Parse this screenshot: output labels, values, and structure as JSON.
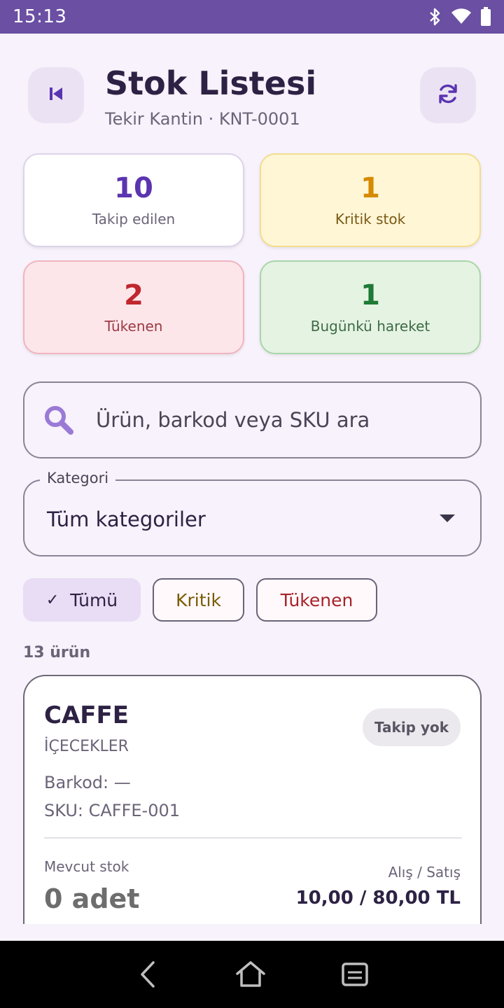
{
  "status_bar": {
    "time": "15:13"
  },
  "header": {
    "title": "Stok Listesi",
    "subtitle": "Tekir Kantin · KNT-0001"
  },
  "stats": {
    "tracked": {
      "value": "10",
      "label": "Takip edilen"
    },
    "critical": {
      "value": "1",
      "label": "Kritik stok"
    },
    "out": {
      "value": "2",
      "label": "Tükenen"
    },
    "moves": {
      "value": "1",
      "label": "Bugünkü hareket"
    }
  },
  "search": {
    "placeholder": "Ürün, barkod veya SKU ara",
    "value": ""
  },
  "category_select": {
    "label": "Kategori",
    "selected": "Tüm kategoriler"
  },
  "filters": {
    "all": "Tümü",
    "critical": "Kritik",
    "out": "Tükenen",
    "selected": "all"
  },
  "result_count": "13 ürün",
  "products": [
    {
      "name": "CAFFE",
      "category": "İÇECEKLER",
      "badge": "Takip yok",
      "barcode": "Barkod: —",
      "sku": "SKU: CAFFE-001",
      "stock_label": "Mevcut stok",
      "stock_value": "0 adet",
      "price_label": "Alış / Satış",
      "price_value": "10,00 / 80,00 TL"
    }
  ],
  "colors": {
    "accent": "#6a4fa3",
    "critical": "#d68a00",
    "out": "#c0262d",
    "moves": "#1f7a35"
  }
}
